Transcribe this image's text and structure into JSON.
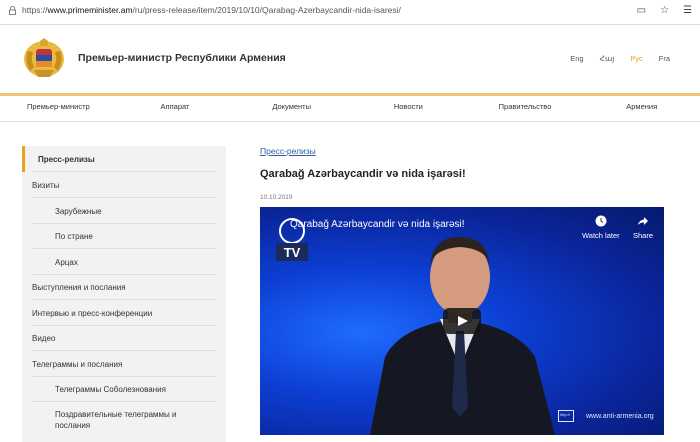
{
  "browser": {
    "url_prefix": "https://",
    "url_host": "www.primeminister.am",
    "url_path": "/ru/press-release/item/2019/10/10/Qarabag-Azerbaycandir-nida-isaresi/"
  },
  "header": {
    "site_title": "Премьер-министр Республики Армения",
    "languages": [
      "Eng",
      "Հայ",
      "Рус",
      "Fra"
    ],
    "active_language": "Рус"
  },
  "nav": [
    "Премьер-министр",
    "Аппарат",
    "Документы",
    "Новости",
    "Правительство",
    "Армения"
  ],
  "sidebar": [
    {
      "label": "Пресс-релизы",
      "level": 0,
      "active": true
    },
    {
      "label": "Визиты",
      "level": 0
    },
    {
      "label": "Зарубежные",
      "level": 1
    },
    {
      "label": "По стране",
      "level": 1
    },
    {
      "label": "Арцах",
      "level": 1
    },
    {
      "label": "Выступления и послания",
      "level": 0
    },
    {
      "label": "Интервью и пресс-конференции",
      "level": 0
    },
    {
      "label": "Видео",
      "level": 0
    },
    {
      "label": "Телеграммы и послания",
      "level": 0
    },
    {
      "label": "Телеграммы Соболезнования",
      "level": 1
    },
    {
      "label": "Поздравительные телеграммы и послания",
      "level": 1
    }
  ],
  "main": {
    "breadcrumb": "Пресс-релизы",
    "title": "Qarabağ Azərbaycandir və nida işarəsi!",
    "date": "10.10.2019"
  },
  "video": {
    "title": "Qarabağ Azərbaycandir və nida işarəsi!",
    "watch_later": "Watch later",
    "share": "Share",
    "channel_label": "TV",
    "watermark": "www.anti-armenia.org",
    "watermark_box": "http://"
  },
  "colors": {
    "accent": "#e8a31e",
    "gold_line": "#eec57a",
    "sidebar_bg": "#f2f2f2",
    "link": "#2d5fa0",
    "video_bg": "#0d3fd4"
  }
}
